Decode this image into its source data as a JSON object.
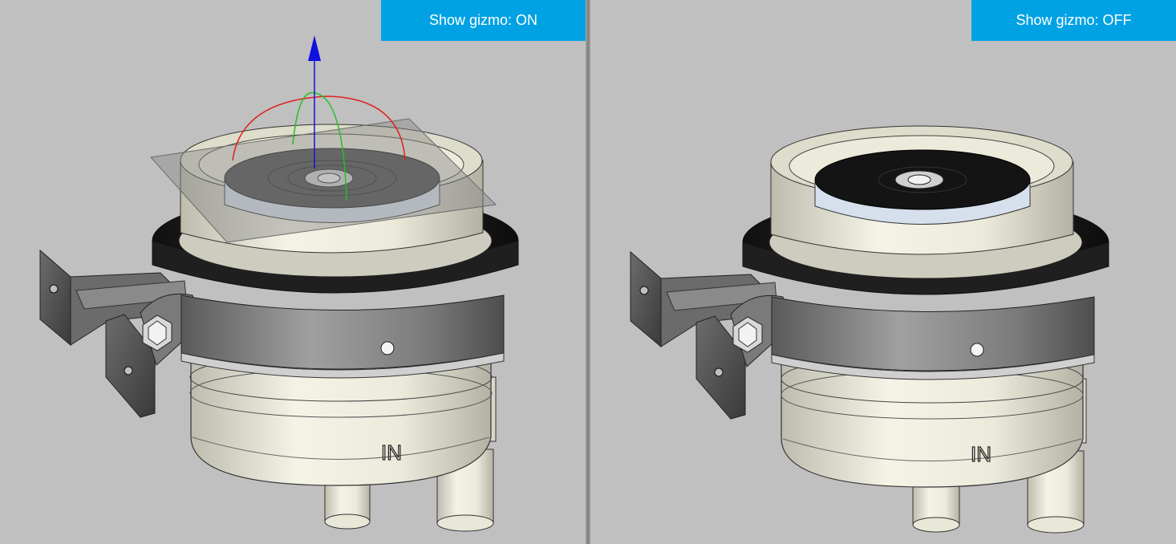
{
  "viewports": {
    "left": {
      "toggle_label": "Show gizmo: ON",
      "gizmo_visible": true
    },
    "right": {
      "toggle_label": "Show gizmo: OFF",
      "gizmo_visible": false
    }
  },
  "model": {
    "inlet_label": "IN"
  },
  "colors": {
    "background": "#c0c0c0",
    "button": "#00a2e4",
    "button_text": "#ffffff",
    "gizmo_x": "#e02020",
    "gizmo_y": "#20c020",
    "gizmo_z": "#1010e0",
    "body": "#ecebdc",
    "ring": "#1e1e1e",
    "band": "#7d7d7d"
  }
}
